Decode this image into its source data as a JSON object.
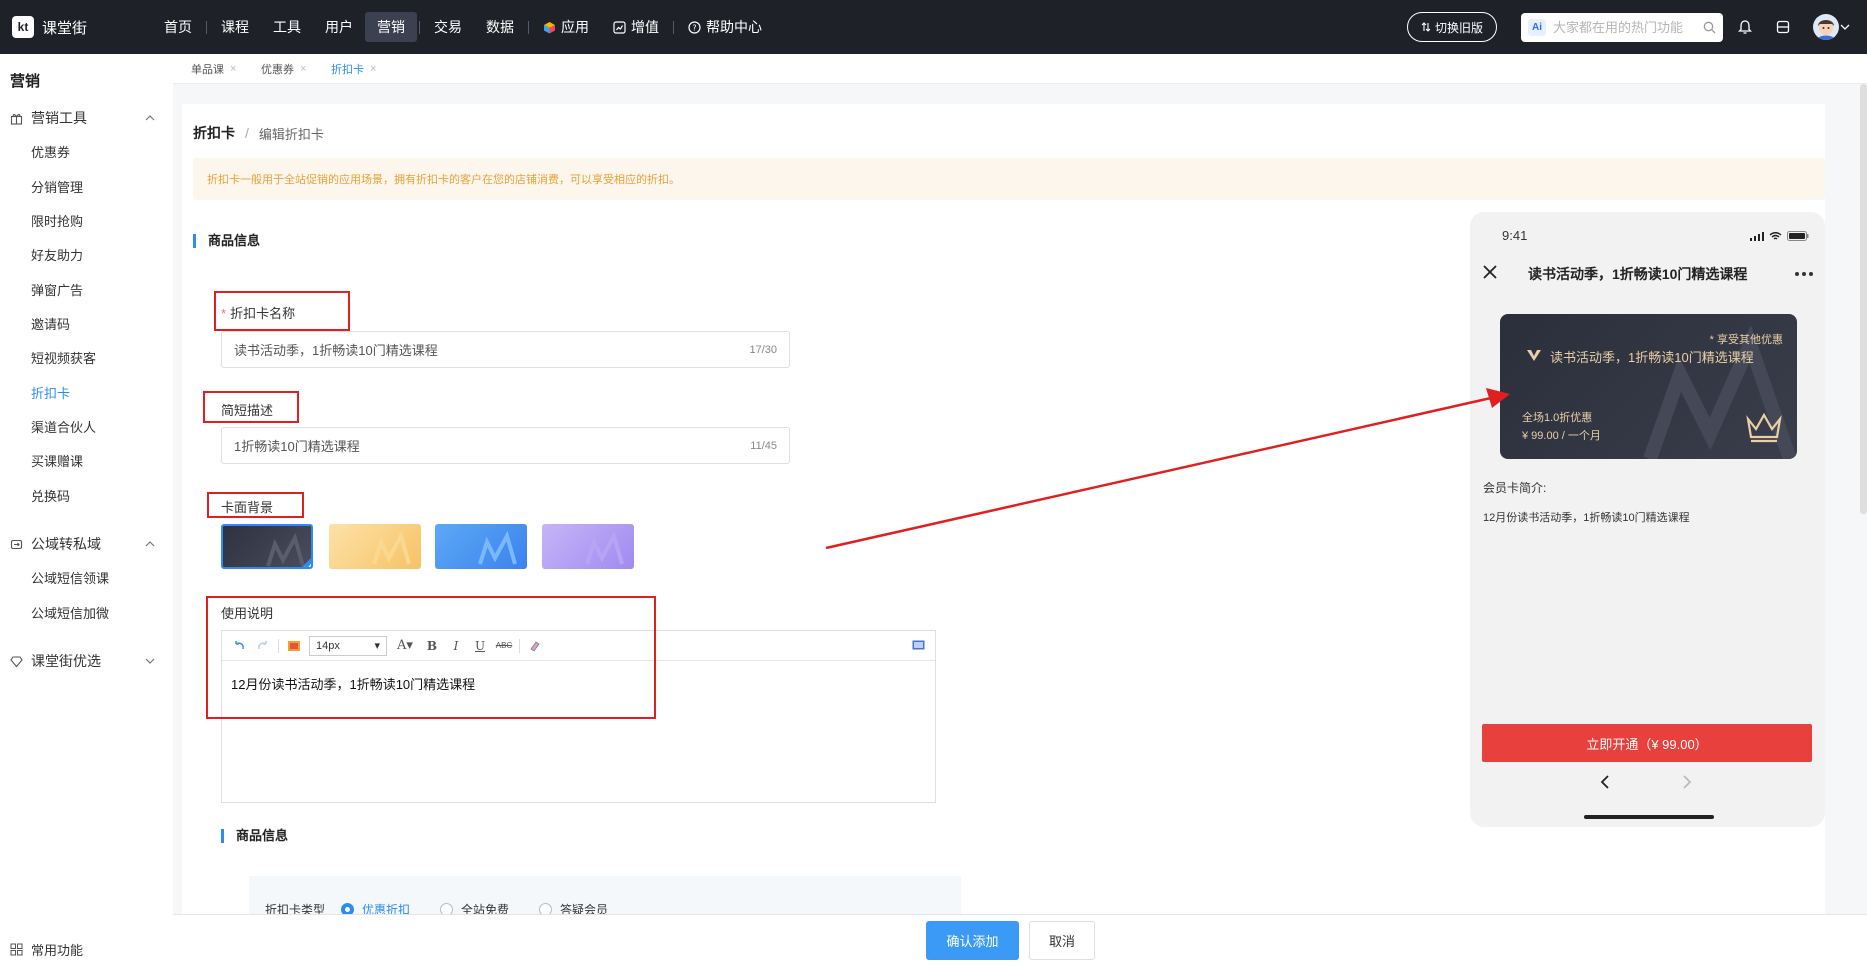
{
  "app": {
    "logo_text": "课堂街"
  },
  "nav": {
    "items": [
      {
        "label": "首页",
        "icon": ""
      },
      {
        "label": "课程",
        "icon": ""
      },
      {
        "label": "工具",
        "icon": ""
      },
      {
        "label": "用户",
        "icon": ""
      },
      {
        "label": "营销",
        "icon": "",
        "active": true
      },
      {
        "label": "交易",
        "icon": ""
      },
      {
        "label": "数据",
        "icon": ""
      },
      {
        "label": "应用",
        "icon": "cube-icon"
      },
      {
        "label": "增值",
        "icon": "chart-icon"
      },
      {
        "label": "帮助中心",
        "icon": "help-icon"
      }
    ]
  },
  "header": {
    "switch_label": "切换旧版",
    "ai_badge": "Ai",
    "search_placeholder": "大家都在用的热门功能"
  },
  "sidebar": {
    "title": "营销",
    "groups": [
      {
        "label": "营销工具",
        "icon": "gift-icon",
        "expanded": true,
        "items": [
          "优惠券",
          "分销管理",
          "限时抢购",
          "好友助力",
          "弹窗广告",
          "邀请码",
          "短视频获客",
          "折扣卡",
          "渠道合伙人",
          "买课赠课",
          "兑换码"
        ]
      },
      {
        "label": "公域转私域",
        "icon": "transfer-icon",
        "expanded": true,
        "items": [
          "公域短信领课",
          "公域短信加微"
        ]
      },
      {
        "label": "课堂街优选",
        "icon": "diamond-icon",
        "expanded": false,
        "items": []
      }
    ],
    "active_item": "折扣卡",
    "bottom": "常用功能"
  },
  "tabs": [
    {
      "label": "单品课",
      "active": false
    },
    {
      "label": "优惠券",
      "active": false
    },
    {
      "label": "折扣卡",
      "active": true
    }
  ],
  "page": {
    "breadcrumb": {
      "root": "折扣卡",
      "separator": "/",
      "current": "编辑折扣卡"
    },
    "notice": "折扣卡一般用于全站促销的应用场景，拥有折扣卡的客户在您的店铺消费，可以享受相应的折扣。",
    "section1": "商品信息",
    "name_label": "折扣卡名称",
    "name_value": "读书活动季，1折畅读10门精选课程",
    "name_count": "17/30",
    "desc_label": "简短描述",
    "desc_value": "1折畅读10门精选课程",
    "desc_count": "11/45",
    "bg_label": "卡面背景",
    "backgrounds": [
      {
        "name": "dark",
        "colors": [
          "#2e3140",
          "#4a4d5c"
        ],
        "selected": true
      },
      {
        "name": "gold",
        "colors": [
          "#fde2a8",
          "#f6c265"
        ],
        "selected": false
      },
      {
        "name": "blue",
        "colors": [
          "#5da9f6",
          "#3b82ee"
        ],
        "selected": false
      },
      {
        "name": "purple",
        "colors": [
          "#c6b5f7",
          "#a08af0"
        ],
        "selected": false
      }
    ],
    "usage_label": "使用说明",
    "editor_font_size": "14px",
    "editor_content": "12月份读书活动季，1折畅读10门精选课程",
    "section2": "商品信息",
    "type_label": "折扣卡类型",
    "type_options": [
      {
        "label": "优惠折扣",
        "selected": true
      },
      {
        "label": "全站免费",
        "selected": false
      },
      {
        "label": "答疑会员",
        "selected": false
      }
    ]
  },
  "footer": {
    "confirm_label": "确认添加",
    "cancel_label": "取消"
  },
  "preview": {
    "time": "9:41",
    "title": "读书活动季，1折畅读10门精选课程",
    "card_badge": "* 享受其他优惠",
    "card_name": "读书活动季，1折畅读10门精选课程",
    "card_discount": "全场1.0折优惠",
    "card_price": "¥ 99.00 / 一个月",
    "intro_label": "会员卡简介:",
    "intro_text": "12月份读书活动季，1折畅读10门精选课程",
    "buy_label": "立即开通（¥ 99.00）"
  },
  "colors": {
    "accent": "#2d8cf0",
    "annotation": "#e02020",
    "topbar": "#1f2129",
    "buy": "#e8403c"
  }
}
